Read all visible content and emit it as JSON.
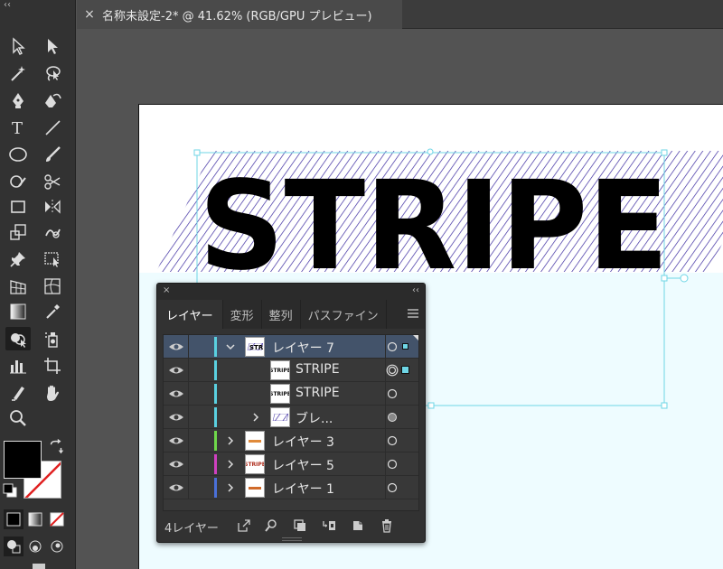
{
  "document_tab": {
    "close_glyph": "×",
    "title": "名称未設定-2* @ 41.62% (RGB/GPU プレビュー)"
  },
  "toolbar": {
    "collapse_glyph": "‹‹",
    "tools": [
      "selection-icon",
      "direct-selection-icon",
      "magic-wand-icon",
      "lasso-icon",
      "pen-icon",
      "curvature-icon",
      "type-icon",
      "line-segment-icon",
      "ellipse-icon",
      "paintbrush-icon",
      "shaper-icon",
      "scissors-icon",
      "rectangle-icon",
      "reflect-icon",
      "scale-icon",
      "warp-icon",
      "pin-icon",
      "free-transform-icon",
      "perspective-grid-icon",
      "mesh-icon",
      "gradient-icon",
      "eyedropper-icon",
      "shape-builder-icon",
      "symbol-sprayer-icon",
      "graph-icon",
      "artboard-icon",
      "slice-icon",
      "hand-icon",
      "zoom-icon"
    ]
  },
  "artwork": {
    "text": "STRIPE",
    "stripe_color": "#3a2aa0",
    "selection_color": "#6fd6e6"
  },
  "layers_panel": {
    "close_glyph": "×",
    "collapse_glyph": "‹‹",
    "tabs": [
      "レイヤー",
      "変形",
      "整列",
      "パスファイン"
    ],
    "active_tab": "レイヤー",
    "rows": [
      {
        "name": "レイヤー 7",
        "color": "#5ad0e0",
        "expanded": true,
        "selected": true,
        "thumb": "stripe-blue"
      },
      {
        "name": "STRIPE",
        "color": "#5ad0e0",
        "thumb": "STRIPE"
      },
      {
        "name": "STRIPE",
        "color": "#5ad0e0",
        "thumb": "STRIPE"
      },
      {
        "name": "ブレ...",
        "color": "#5ad0e0",
        "thumb": "stripe-blue"
      },
      {
        "name": "レイヤー 3",
        "color": "#6fd84a",
        "thumb": "orange"
      },
      {
        "name": "レイヤー 5",
        "color": "#d040c0",
        "thumb": "STRIPE"
      },
      {
        "name": "レイヤー 1",
        "color": "#4a70d8",
        "thumb": "orange"
      }
    ],
    "footer": {
      "count_label": "4レイヤー"
    }
  },
  "colors": {
    "fill": "#000000",
    "stroke": "none"
  }
}
